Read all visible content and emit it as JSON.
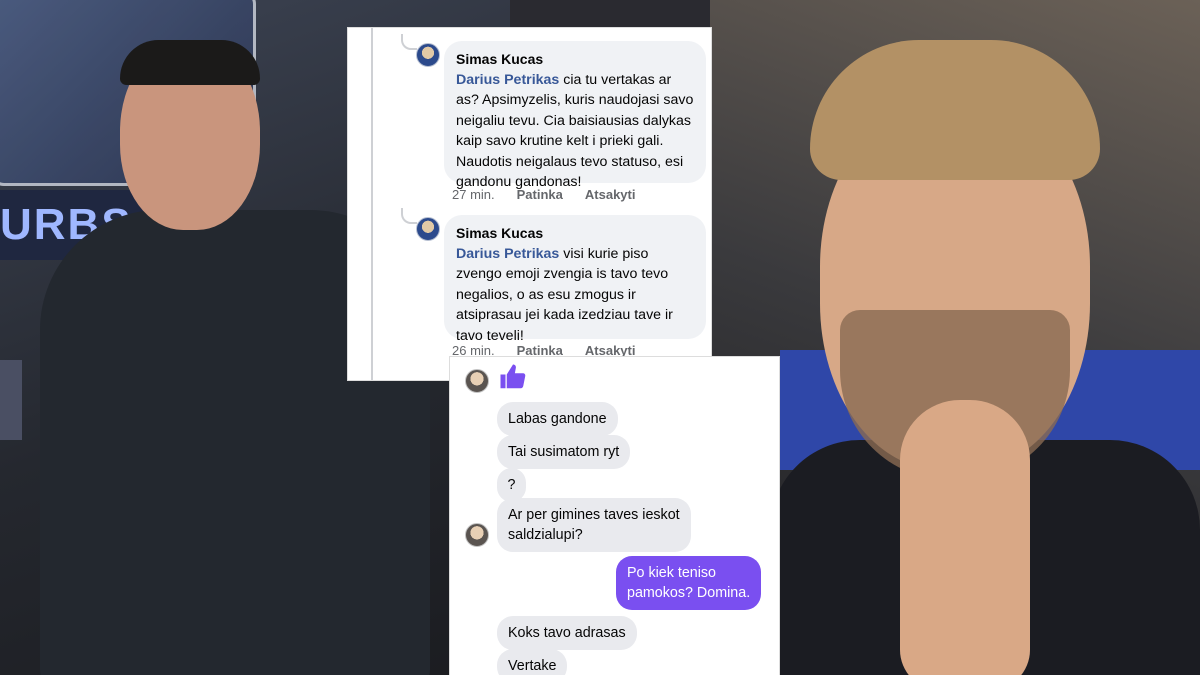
{
  "comments": [
    {
      "author": "Simas Kucas",
      "mention": "Darius Petrikas",
      "text": " cia tu vertakas ar as? Apsimyzelis, kuris naudojasi savo neigaliu tevu. Cia baisiausias dalykas kaip savo krutine kelt i prieki gali. Naudotis neigalaus tevo statuso, esi gandonu gandonas!",
      "time": "27 min.",
      "like": "Patinka",
      "reply": "Atsakyti"
    },
    {
      "author": "Simas Kucas",
      "mention": "Darius Petrikas",
      "text": " visi kurie piso zvengo emoji zvengia is tavo tevo negalios, o as esu zmogus ir atsiprasau jei kada izedziau tave ir tavo teveli!",
      "time": "26 min.",
      "like": "Patinka",
      "reply": "Atsakyti"
    }
  ],
  "messenger": {
    "like_icon": "thumbs-up-icon",
    "like_color": "#7a4ff0",
    "messages": [
      {
        "text": "Labas gandone",
        "from": "them"
      },
      {
        "text": "Tai susimatom ryt",
        "from": "them"
      },
      {
        "text": "?",
        "from": "them"
      },
      {
        "text": "Ar per gimines taves ieskot\nsaldzialupi?",
        "from": "them"
      },
      {
        "text": "Po kiek teniso\npamokos? Domina.",
        "from": "me"
      },
      {
        "text": "Koks tavo adrasas",
        "from": "them"
      },
      {
        "text": "Vertake",
        "from": "them"
      }
    ]
  },
  "photo_left": {
    "banner_text": "URBS"
  }
}
